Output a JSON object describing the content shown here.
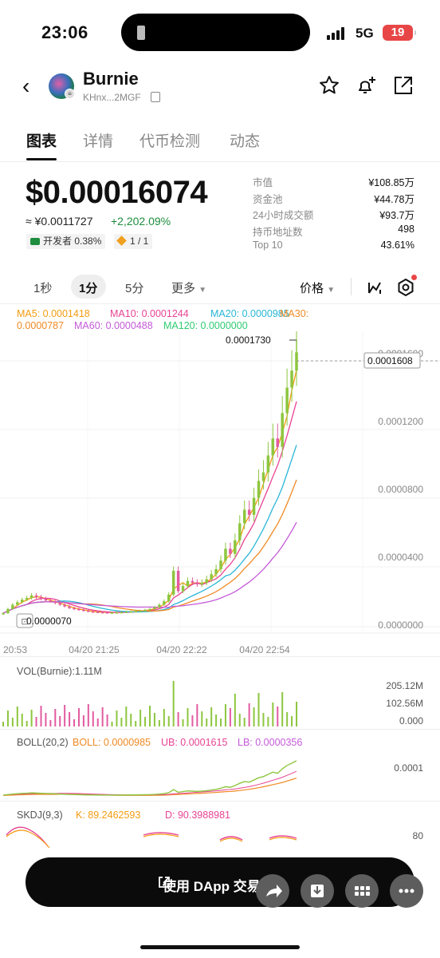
{
  "status": {
    "time": "23:06",
    "network": "5G",
    "battery": "19"
  },
  "header": {
    "name": "Burnie",
    "address": "KHnx...2MGF"
  },
  "tabs": [
    "图表",
    "详情",
    "代币检测",
    "动态"
  ],
  "price": {
    "usd": "$0.00016074",
    "cny": "≈ ¥0.0011727",
    "change": "+2,202.09%",
    "dev_tag": "开发者 0.38%",
    "rank_tag": "1 / 1"
  },
  "stats": [
    {
      "label": "市值",
      "value": "¥108.85万"
    },
    {
      "label": "资金池",
      "value": "¥44.78万"
    },
    {
      "label": "24小时成交额",
      "value": "¥93.7万"
    },
    {
      "label": "持币地址数",
      "value": "498"
    },
    {
      "label": "Top 10",
      "value": "43.61%"
    }
  ],
  "intervals": {
    "i1": "1秒",
    "i2": "1分",
    "i3": "5分",
    "more": "更多",
    "price_sel": "价格"
  },
  "ma": {
    "ma5": "MA5: 0.0001418",
    "ma10": "MA10: 0.0001244",
    "ma20": "MA20: 0.0000985",
    "ma30a": "MA30:",
    "ma30b": "0.0000787",
    "ma60": "MA60: 0.0000488",
    "ma120": "MA120: 0.0000000"
  },
  "colors": {
    "up": "#8dc63f",
    "down": "#e15ba0",
    "ma5": "#f39c12",
    "ma10": "#e84393",
    "ma20": "#29b6d6",
    "ma30": "#f08a24",
    "ma60": "#c45ad8",
    "ma120": "#2ecc71"
  },
  "chart_data": {
    "type": "candlestick",
    "y_ticks": [
      "0.0001600",
      "0.0001200",
      "0.0000800",
      "0.0000400",
      "0.0000000"
    ],
    "x_ticks": [
      "20:53",
      "04/20 21:25",
      "04/20 22:22",
      "04/20 22:54"
    ],
    "high_label": "0.0001730",
    "low_label": "0.0000070",
    "last_price_label": "0.0001608",
    "close": [
      7e-06,
      9.5e-06,
      1.2e-05,
      1.35e-05,
      1.5e-05,
      1.6e-05,
      1.75e-05,
      1.65e-05,
      1.55e-05,
      1.45e-05,
      1.4e-05,
      1.3e-05,
      1.2e-05,
      1.1e-05,
      1e-05,
      9.5e-06,
      9e-06,
      8.5e-06,
      8e-06,
      7.8e-06,
      7.6e-06,
      7.5e-06,
      7.4e-06,
      7.4e-06,
      7.5e-06,
      7.6e-06,
      7.8e-06,
      8e-06,
      8.3e-06,
      8.5e-06,
      9e-06,
      9.5e-06,
      1.05e-05,
      1.2e-05,
      1.4e-05,
      1.8e-05,
      3.2e-05,
      2e-05,
      2.3e-05,
      2.6e-05,
      2.5e-05,
      2.4e-05,
      2.5e-05,
      2.7e-05,
      3e-05,
      3.3e-05,
      3.8e-05,
      4.5e-05,
      4.2e-05,
      5e-05,
      6e-05,
      6.8e-05,
      6.5e-05,
      7.5e-05,
      8.5e-05,
      9e-05,
      0.0001,
      0.00011,
      0.000105,
      0.000125,
      0.00014,
      0.00015,
      0.0001608
    ]
  },
  "vol": {
    "label": "VOL(Burnie):1.11M",
    "ticks": [
      "205.12M",
      "102.56M",
      "0.000"
    ]
  },
  "boll": {
    "name": "BOLL(20,2)",
    "boll": "BOLL: 0.0000985",
    "ub": "UB: 0.0001615",
    "lb": "LB: 0.0000356",
    "tick": "0.0001"
  },
  "skdj": {
    "name": "SKDJ(9,3)",
    "k": "K: 89.2462593",
    "d": "D: 90.3988981",
    "tick": "80"
  },
  "bottom": {
    "dapp": "使用 DApp 交易"
  }
}
